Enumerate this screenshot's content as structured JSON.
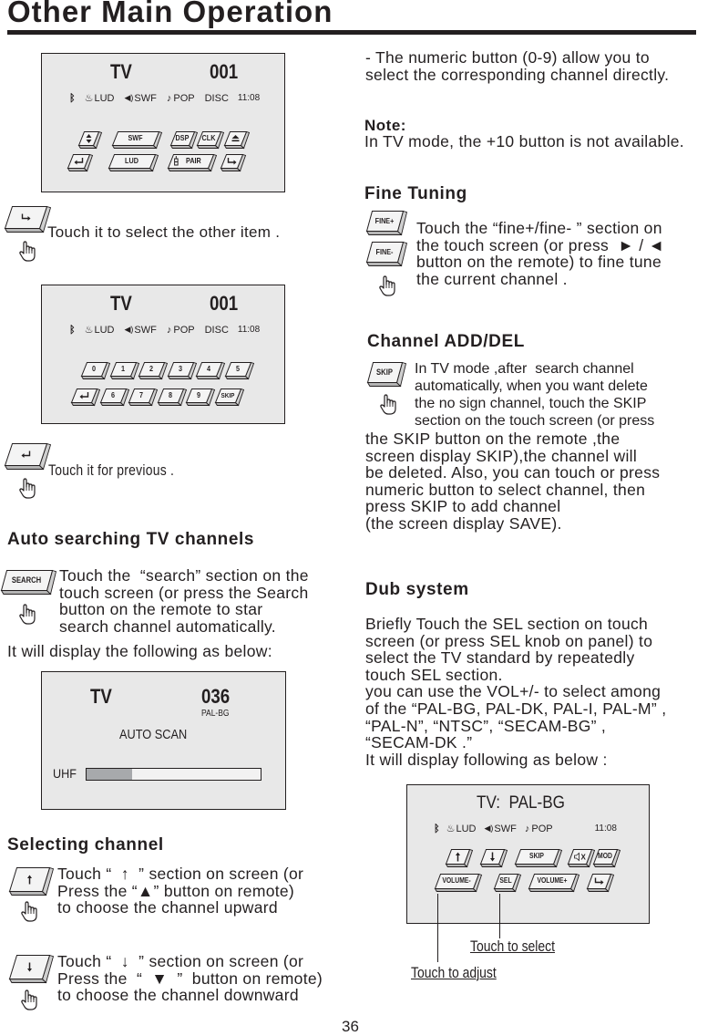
{
  "page": {
    "title": "Other Main Operation",
    "page_number": "36"
  },
  "panel1": {
    "source": "TV",
    "channel": "001",
    "status": {
      "bt_icon": "bluetooth-icon",
      "lud": "LUD",
      "swf": "SWF",
      "pop": "POP",
      "disc": "DISC",
      "time": "11:08"
    },
    "buttons_row1": [
      {
        "name": "updown",
        "label": "",
        "icon": "up-down-arrows-icon"
      },
      {
        "name": "swf",
        "label": "SWF"
      },
      {
        "name": "dsp",
        "label": "DSP"
      },
      {
        "name": "clk",
        "label": "CLK"
      },
      {
        "name": "eject",
        "label": "",
        "icon": "eject-icon"
      }
    ],
    "buttons_row2": [
      {
        "name": "previous",
        "label": "",
        "icon": "return-arrow-icon"
      },
      {
        "name": "lud",
        "label": "LUD"
      },
      {
        "name": "pair",
        "label": "PAIR",
        "icon": "phone-icon"
      },
      {
        "name": "next",
        "label": "",
        "icon": "next-arrow-icon"
      }
    ]
  },
  "next_item": {
    "text": "Touch it to select the other item ."
  },
  "panel2": {
    "source": "TV",
    "channel": "001",
    "status": {
      "lud": "LUD",
      "swf": "SWF",
      "pop": "POP",
      "disc": "DISC",
      "time": "11:08"
    },
    "buttons_row1": [
      "0",
      "1",
      "2",
      "3",
      "4",
      "5"
    ],
    "buttons_row2": [
      "",
      "6",
      "7",
      "8",
      "9",
      "SKIP"
    ]
  },
  "previous_item": {
    "text": "Touch it for previous ."
  },
  "auto_search": {
    "heading": "Auto searching TV channels",
    "button_label": "SEARCH",
    "text": "Touch the  “search” section on the\ntouch screen (or press the Search\nbutton on the remote to star\nsearch channel automatically.",
    "text2": "It will display the following as below:"
  },
  "panel3": {
    "source": "TV",
    "channel": "036",
    "standard": "PAL-BG",
    "mode": "AUTO SCAN",
    "band": "UHF",
    "progress": 0.26
  },
  "selecting_channel": {
    "heading": "Selecting channel",
    "up_text": "Touch “  ↑  ” section on screen (or\nPress the “▲” button on remote)\nto choose the channel upward",
    "down_text": "Touch “  ↓  ” section on screen (or\nPress the  “  ▼  ”  button on remote)\nto choose the channel downward"
  },
  "numeric_note": {
    "text": "- The numeric button (0-9) allow you to\nselect the corresponding channel directly."
  },
  "note": {
    "label": "Note:",
    "text": "In TV mode, the +10 button is not available."
  },
  "fine_tuning": {
    "heading": "Fine Tuning",
    "button_plus": "FINE+",
    "button_minus": "FINE-",
    "text": "Touch the “fine+/fine- ” section on\nthe touch screen (or press  ► / ◄\nbutton on the remote) to fine tune\nthe current channel ."
  },
  "channel_add_del": {
    "heading": "Channel ADD/DEL",
    "button_label": "SKIP",
    "text_indented": "In TV mode ,after  search channel\nautomatically, when you want delete\nthe no sign channel, touch the SKIP\nsection on the touch screen (or press",
    "text_full": "the SKIP button on the remote ,the\nscreen display SKIP),the channel will\nbe deleted. Also, you can touch or press\nnumeric button to select channel, then\npress SKIP to add channel\n(the screen display SAVE)."
  },
  "dub_system": {
    "heading": "Dub system",
    "text": "Briefly Touch the SEL section on touch\nscreen (or press SEL knob on panel) to\nselect the TV standard by repeatedly\ntouch SEL section.\nyou can use the VOL+/- to select among\nof the “PAL-BG, PAL-DK, PAL-I, PAL-M” ,\n“PAL-N”, “NTSC”, “SECAM-BG” ,\n“SECAM-DK .”\nIt will display following as below :"
  },
  "panel4": {
    "title": "TV:  PAL-BG",
    "status": {
      "lud": "LUD",
      "swf": "SWF",
      "pop": "POP",
      "time": "11:08"
    },
    "buttons_row1": [
      {
        "name": "up",
        "label": "",
        "icon": "up-arrow-icon"
      },
      {
        "name": "down",
        "label": "",
        "icon": "down-arrow-icon"
      },
      {
        "name": "skip",
        "label": "SKIP"
      },
      {
        "name": "mute",
        "label": "",
        "icon": "mute-icon"
      },
      {
        "name": "mod",
        "label": "MOD"
      }
    ],
    "buttons_row2": [
      {
        "name": "volume-down",
        "label": "VOLUME-"
      },
      {
        "name": "sel",
        "label": "SEL"
      },
      {
        "name": "volume-up",
        "label": "VOLUME+"
      },
      {
        "name": "next",
        "label": "",
        "icon": "next-arrow-icon"
      }
    ],
    "callout_select": "Touch to select",
    "callout_adjust": "Touch to adjust"
  }
}
